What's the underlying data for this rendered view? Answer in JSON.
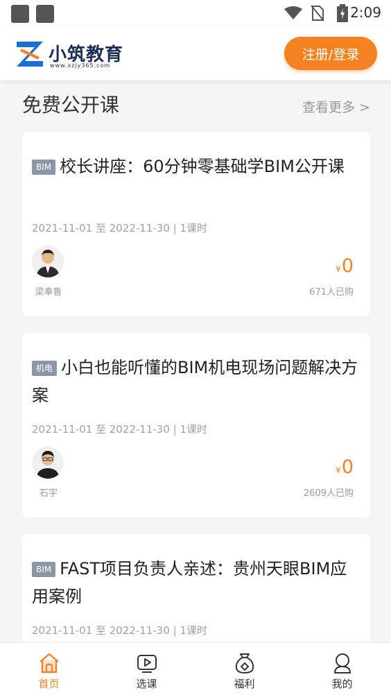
{
  "status_bar": {
    "time": "2:09"
  },
  "header": {
    "brand_name": "小筑教育",
    "brand_url": "www.xzjy365.com",
    "login_button": "注册/登录"
  },
  "section": {
    "title": "免费公开课",
    "more": "查看更多 >"
  },
  "courses": [
    {
      "tag": "BIM",
      "title": "校长讲座：60分钟零基础学BIM公开课",
      "date": "2021-11-01 至 2022-11-30 | 1课时",
      "teacher": "梁奉鲁",
      "currency": "¥",
      "price": "0",
      "buyers": "671人已购"
    },
    {
      "tag": "机电",
      "title": "小白也能听懂的BIM机电现场问题解决方案",
      "date": "2021-11-01 至 2022-11-30 | 1课时",
      "teacher": "石宇",
      "currency": "¥",
      "price": "0",
      "buyers": "2609人已购"
    },
    {
      "tag": "BIM",
      "title": "FAST项目负责人亲述：贵州天眼BIM应用案例",
      "date": "2021-11-01 至 2022-11-30 | 1课时"
    }
  ],
  "tabbar": {
    "items": [
      {
        "label": "首页",
        "icon": "home-icon",
        "active": true
      },
      {
        "label": "选课",
        "icon": "play-icon",
        "active": false
      },
      {
        "label": "福利",
        "icon": "gift-icon",
        "active": false
      },
      {
        "label": "我的",
        "icon": "user-icon",
        "active": false
      }
    ]
  },
  "colors": {
    "accent": "#f58220",
    "brand_blue": "#1a6fd0",
    "tag_gray": "#8c96a6"
  }
}
